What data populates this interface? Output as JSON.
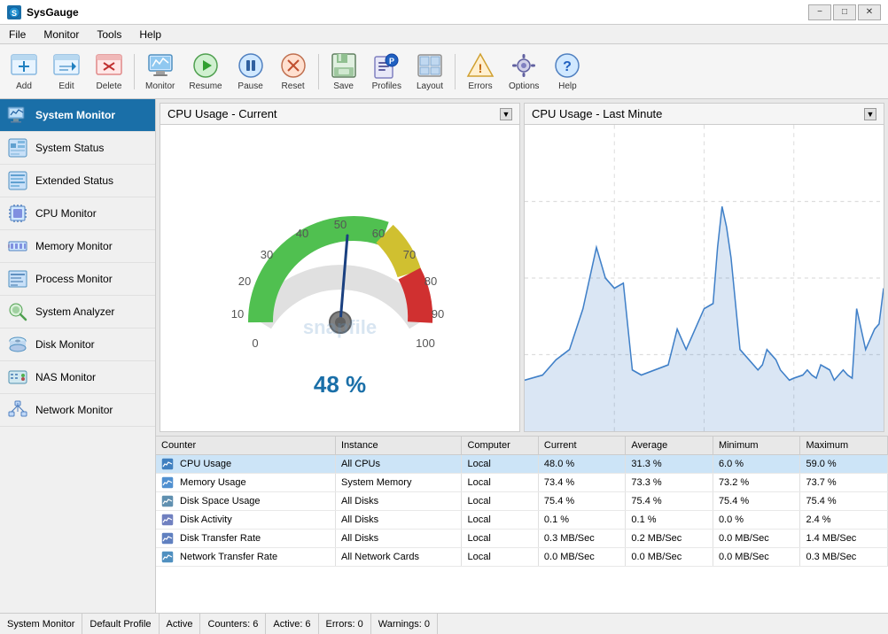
{
  "window": {
    "title": "SysGauge",
    "controls": [
      "minimize",
      "maximize",
      "close"
    ]
  },
  "menu": {
    "items": [
      "File",
      "Monitor",
      "Tools",
      "Help"
    ]
  },
  "toolbar": {
    "buttons": [
      {
        "id": "add",
        "label": "Add",
        "icon": "add-icon"
      },
      {
        "id": "edit",
        "label": "Edit",
        "icon": "edit-icon"
      },
      {
        "id": "delete",
        "label": "Delete",
        "icon": "delete-icon"
      },
      {
        "id": "monitor",
        "label": "Monitor",
        "icon": "monitor-icon"
      },
      {
        "id": "resume",
        "label": "Resume",
        "icon": "resume-icon"
      },
      {
        "id": "pause",
        "label": "Pause",
        "icon": "pause-icon"
      },
      {
        "id": "reset",
        "label": "Reset",
        "icon": "reset-icon"
      },
      {
        "id": "save",
        "label": "Save",
        "icon": "save-icon"
      },
      {
        "id": "profiles",
        "label": "Profiles",
        "icon": "profiles-icon"
      },
      {
        "id": "layout",
        "label": "Layout",
        "icon": "layout-icon"
      },
      {
        "id": "errors",
        "label": "Errors",
        "icon": "errors-icon"
      },
      {
        "id": "options",
        "label": "Options",
        "icon": "options-icon"
      },
      {
        "id": "help",
        "label": "Help",
        "icon": "help-icon"
      }
    ]
  },
  "sidebar": {
    "items": [
      {
        "id": "system-monitor",
        "label": "System Monitor",
        "active": true
      },
      {
        "id": "system-status",
        "label": "System Status"
      },
      {
        "id": "extended-status",
        "label": "Extended Status"
      },
      {
        "id": "cpu-monitor",
        "label": "CPU Monitor"
      },
      {
        "id": "memory-monitor",
        "label": "Memory Monitor"
      },
      {
        "id": "process-monitor",
        "label": "Process Monitor"
      },
      {
        "id": "system-analyzer",
        "label": "System Analyzer"
      },
      {
        "id": "disk-monitor",
        "label": "Disk Monitor"
      },
      {
        "id": "nas-monitor",
        "label": "NAS Monitor"
      },
      {
        "id": "network-monitor",
        "label": "Network Monitor"
      }
    ]
  },
  "gauge_panel": {
    "title": "CPU Usage - Current",
    "value": "48 %",
    "value_numeric": 48
  },
  "chart_panel": {
    "title": "CPU Usage - Last Minute"
  },
  "table": {
    "headers": [
      "Counter",
      "Instance",
      "Computer",
      "Current",
      "Average",
      "Minimum",
      "Maximum"
    ],
    "rows": [
      {
        "counter": "CPU Usage",
        "instance": "All CPUs",
        "computer": "Local",
        "current": "48.0 %",
        "average": "31.3 %",
        "minimum": "6.0 %",
        "maximum": "59.0 %",
        "selected": true
      },
      {
        "counter": "Memory Usage",
        "instance": "System Memory",
        "computer": "Local",
        "current": "73.4 %",
        "average": "73.3 %",
        "minimum": "73.2 %",
        "maximum": "73.7 %",
        "selected": false
      },
      {
        "counter": "Disk Space Usage",
        "instance": "All Disks",
        "computer": "Local",
        "current": "75.4 %",
        "average": "75.4 %",
        "minimum": "75.4 %",
        "maximum": "75.4 %",
        "selected": false
      },
      {
        "counter": "Disk Activity",
        "instance": "All Disks",
        "computer": "Local",
        "current": "0.1 %",
        "average": "0.1 %",
        "minimum": "0.0 %",
        "maximum": "2.4 %",
        "selected": false
      },
      {
        "counter": "Disk Transfer Rate",
        "instance": "All Disks",
        "computer": "Local",
        "current": "0.3 MB/Sec",
        "average": "0.2 MB/Sec",
        "minimum": "0.0 MB/Sec",
        "maximum": "1.4 MB/Sec",
        "selected": false
      },
      {
        "counter": "Network Transfer Rate",
        "instance": "All Network Cards",
        "computer": "Local",
        "current": "0.0 MB/Sec",
        "average": "0.0 MB/Sec",
        "minimum": "0.0 MB/Sec",
        "maximum": "0.3 MB/Sec",
        "selected": false
      }
    ]
  },
  "status_bar": {
    "monitor": "System Monitor",
    "profile": "Default Profile",
    "state": "Active",
    "counters": "Counters: 6",
    "active": "Active: 6",
    "errors": "Errors: 0",
    "warnings": "Warnings: 0"
  }
}
